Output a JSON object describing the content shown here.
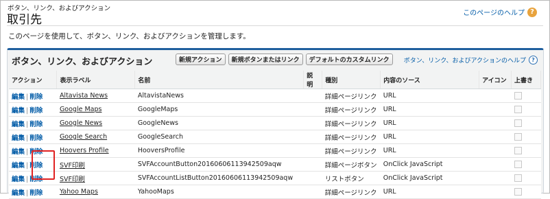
{
  "header": {
    "breadcrumb": "ボタン、リンク、およびアクション",
    "title": "取引先",
    "help_link": "このページのヘルプ",
    "description": "このページを使用して、ボタン、リンク、およびアクションを管理します。"
  },
  "panel": {
    "title": "ボタン、リンク、およびアクション",
    "buttons": [
      "新規アクション",
      "新規ボタンまたはリンク",
      "デフォルトのカスタムリンク"
    ],
    "help_link": "ボタン、リンク、およびアクションのヘルプ"
  },
  "table": {
    "columns": [
      "アクション",
      "表示ラベル",
      "名前",
      "説明",
      "種別",
      "内容のソース",
      "アイコン",
      "上書き"
    ],
    "edit_label": "編集",
    "delete_label": "削除",
    "rows": [
      {
        "label": "Altavista News",
        "name": "AltavistaNews",
        "desc": "",
        "type": "詳細ページリンク",
        "source": "URL"
      },
      {
        "label": "Google Maps",
        "name": "GoogleMaps",
        "desc": "",
        "type": "詳細ページリンク",
        "source": "URL"
      },
      {
        "label": "Google News",
        "name": "GoogleNews",
        "desc": "",
        "type": "詳細ページリンク",
        "source": "URL"
      },
      {
        "label": "Google Search",
        "name": "GoogleSearch",
        "desc": "",
        "type": "詳細ページリンク",
        "source": "URL"
      },
      {
        "label": "Hoovers Profile",
        "name": "HooversProfile",
        "desc": "",
        "type": "詳細ページリンク",
        "source": "URL"
      },
      {
        "label": "SVF印刷",
        "name": "SVFAccountButton20160606113942509aqw",
        "desc": "",
        "type": "詳細ページボタン",
        "source": "OnClick JavaScript"
      },
      {
        "label": "SVF印刷",
        "name": "SVFAccountListButton20160606113942509aqw",
        "desc": "",
        "type": "リストボタン",
        "source": "OnClick JavaScript"
      },
      {
        "label": "Yahoo Maps",
        "name": "YahooMaps",
        "desc": "",
        "type": "詳細ページリンク",
        "source": "URL"
      }
    ]
  },
  "colors": {
    "link": "#015ba7",
    "panel_border": "#1f5f9e",
    "highlight": "#e02020",
    "help_icon": "#e8a33d"
  },
  "icons": {
    "help": "question-circle-icon"
  }
}
